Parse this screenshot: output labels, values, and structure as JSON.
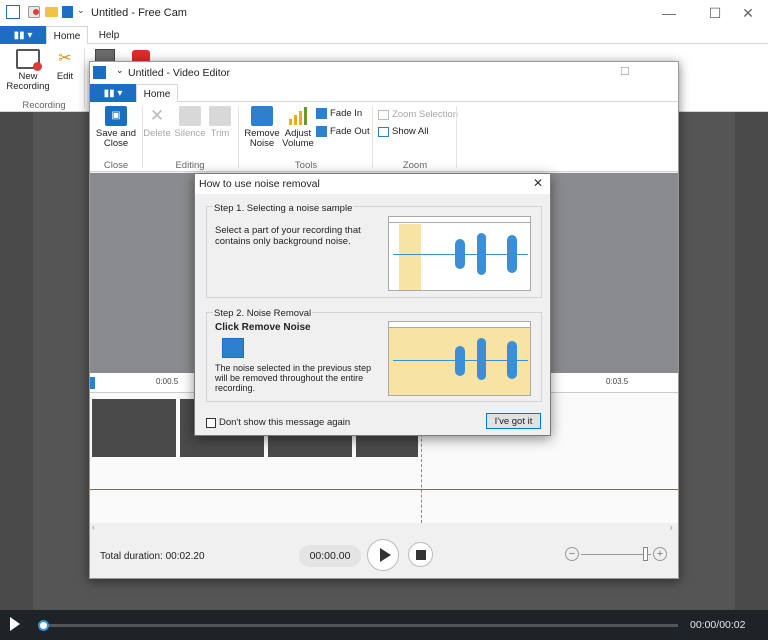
{
  "outer": {
    "title": "Untitled - Free Cam",
    "tabs": [
      "Home",
      "Help"
    ],
    "ribbon": {
      "new_recording": "New\nRecording",
      "edit": "Edit",
      "group_recording": "Recording"
    },
    "window_buttons": {
      "minimize": "—",
      "maximize": "☐",
      "close": "✕"
    }
  },
  "editor": {
    "title": "Untitled - Video Editor",
    "tab": "Home",
    "buttons": {
      "save_close": "Save and\nClose",
      "delete": "Delete",
      "silence": "Silence",
      "trim": "Trim",
      "remove_noise": "Remove\nNoise",
      "adjust_volume": "Adjust\nVolume",
      "fade_in": "Fade In",
      "fade_out": "Fade Out",
      "zoom_selection": "Zoom Selection",
      "show_all": "Show All"
    },
    "groups": {
      "close": "Close",
      "editing": "Editing",
      "tools": "Tools",
      "zoom": "Zoom"
    },
    "timeline": {
      "tick1": "0:00.5",
      "tick2": "0:03.5"
    },
    "footer": {
      "total_duration": "Total duration: 00:02.20",
      "time": "00:00.00"
    }
  },
  "dialog": {
    "title": "How to use noise removal",
    "step1_title": "Step 1. Selecting a noise sample",
    "step1_text": "Select a part of your recording that contains only background noise.",
    "step2_title": "Step 2. Noise Removal",
    "step2_heading": "Click Remove Noise",
    "step2_text": "The noise selected in the previous step will be removed throughout the entire recording.",
    "checkbox_label": "Don't show this message again",
    "ok_button": "I've got it"
  },
  "player": {
    "time": "00:00/00:02",
    "progress": 0.0
  },
  "colors": {
    "accent": "#1b6ec2",
    "noise_highlight": "#f7e3a4",
    "wave": "#3b8fd8"
  }
}
